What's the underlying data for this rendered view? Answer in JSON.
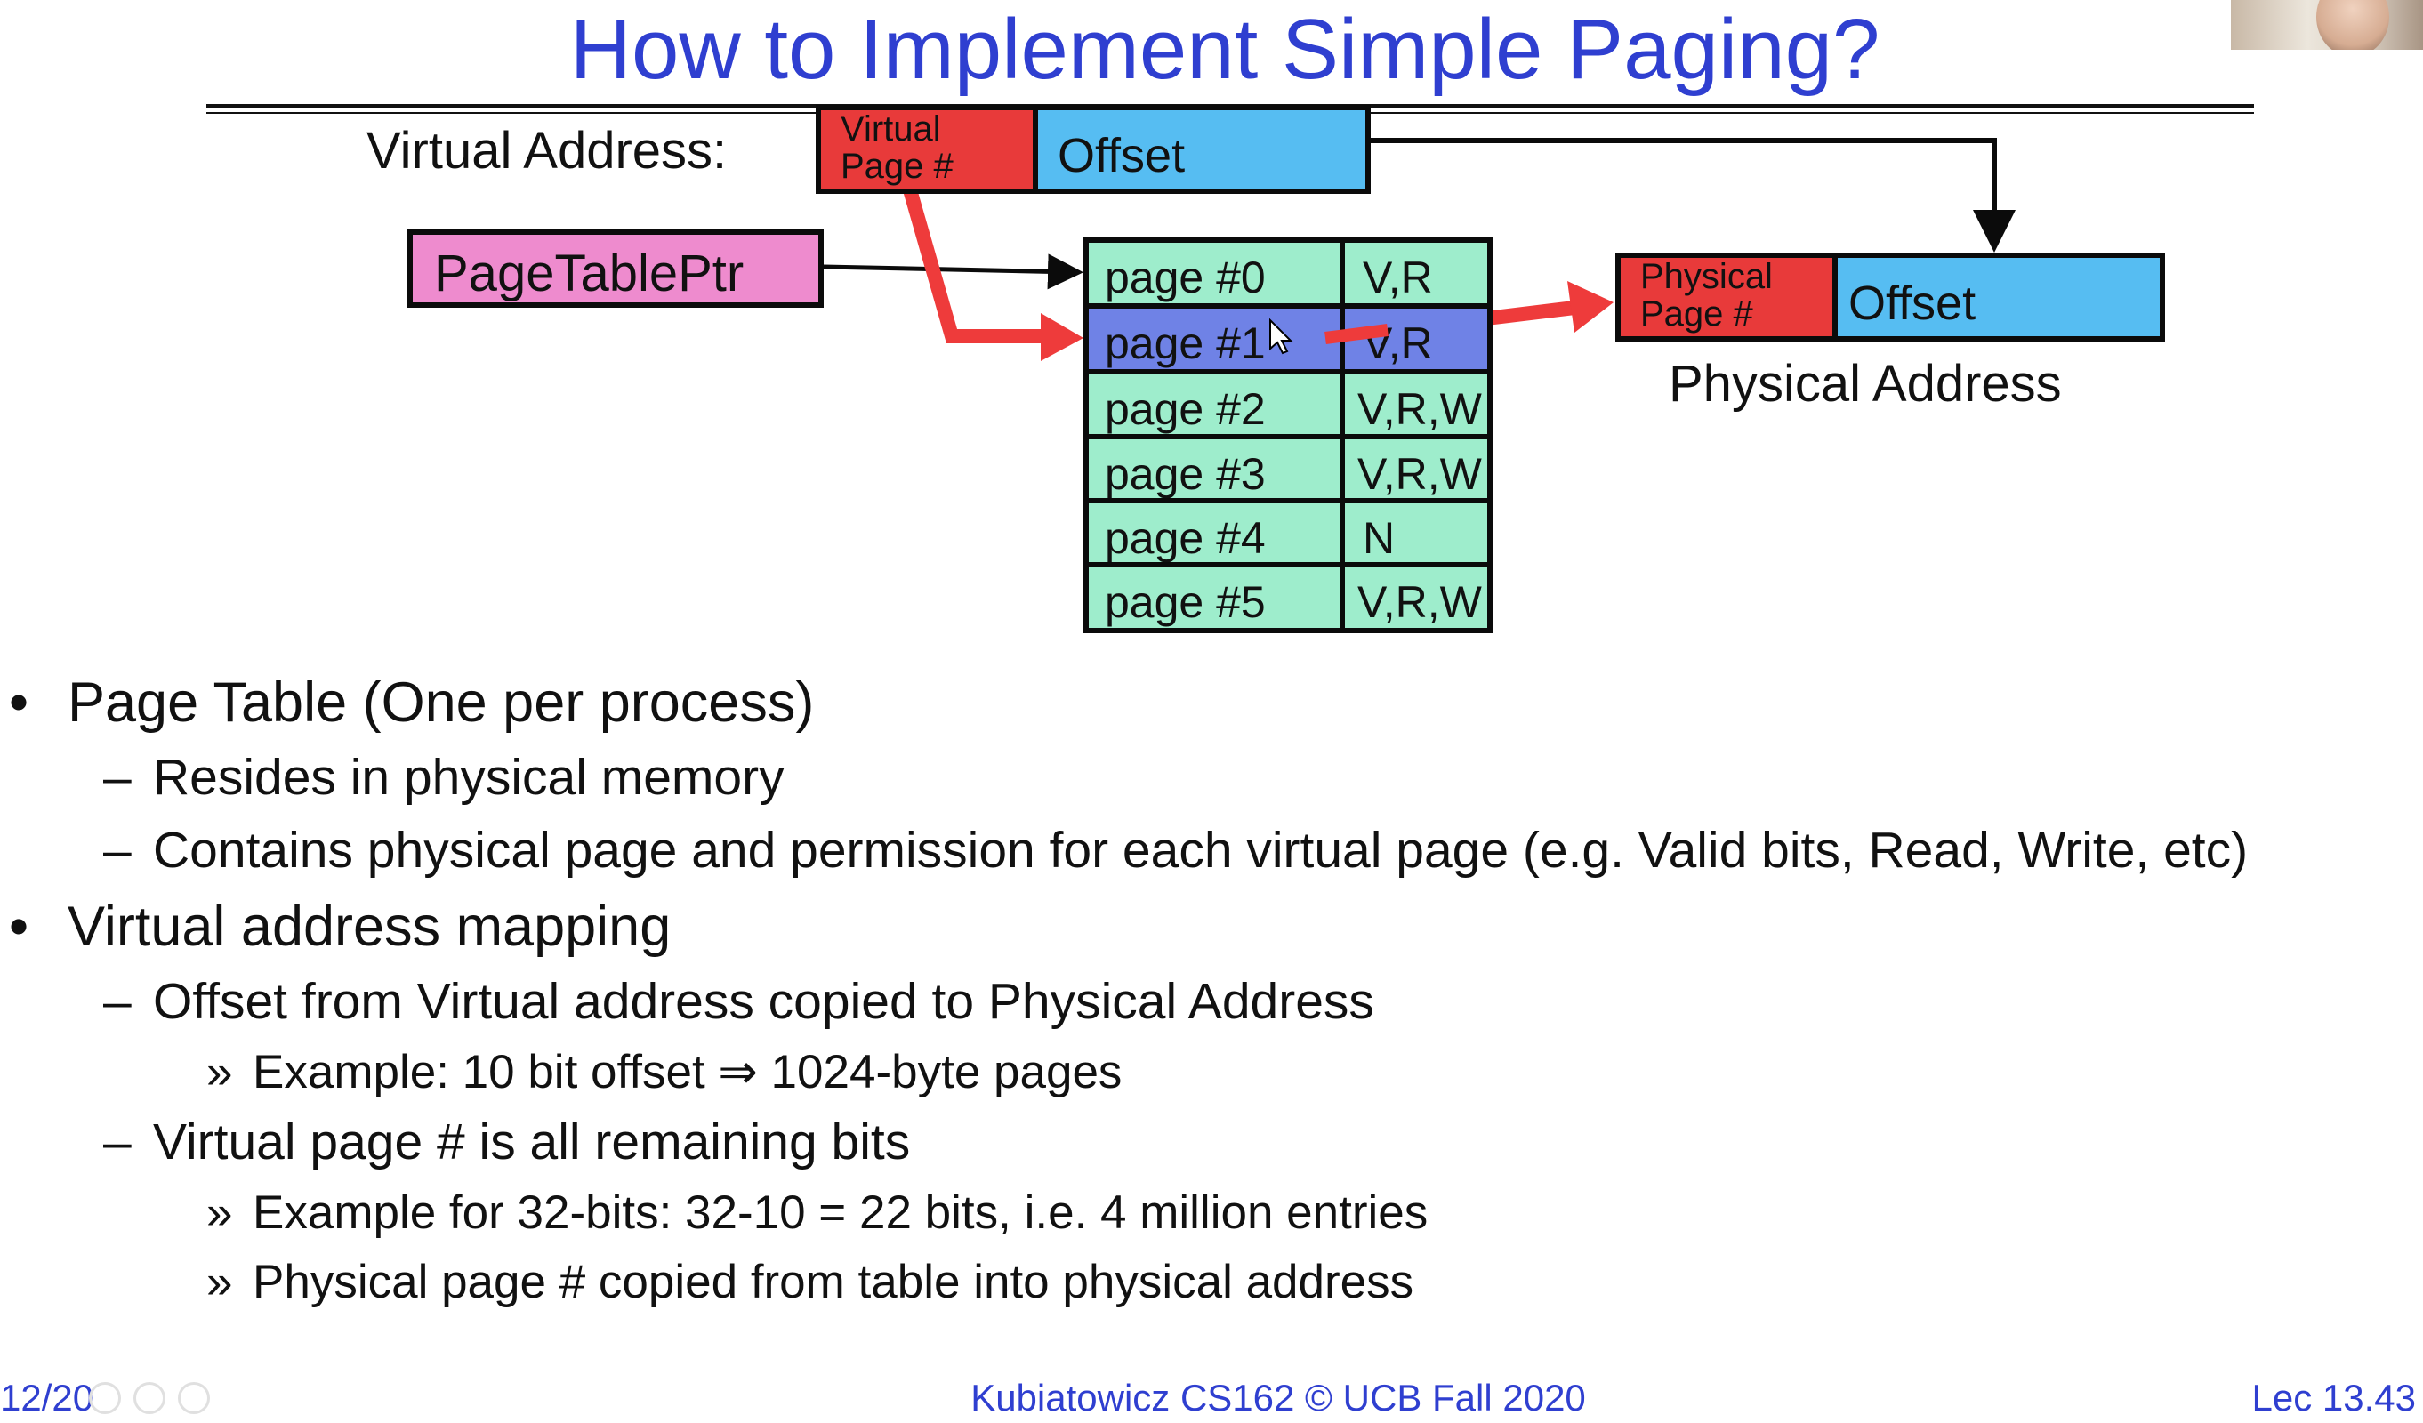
{
  "slide": {
    "title": "How to Implement Simple Paging?",
    "virtual_address_label": "Virtual Address:",
    "va_vpn_line1": "Virtual",
    "va_vpn_line2": "Page #",
    "va_offset": "Offset",
    "page_table_ptr": "PageTablePtr",
    "page_table": [
      {
        "page": "page #0",
        "perm": "V,R"
      },
      {
        "page": "page #1",
        "perm": "V,R"
      },
      {
        "page": "page #2",
        "perm": "V,R,W"
      },
      {
        "page": "page #3",
        "perm": "V,R,W"
      },
      {
        "page": "page #4",
        "perm": "N"
      },
      {
        "page": "page #5",
        "perm": "V,R,W"
      }
    ],
    "pa_ppn_line1": "Physical",
    "pa_ppn_line2": "Page #",
    "pa_offset": "Offset",
    "physical_address_label": "Physical Address",
    "bullets": [
      "Page Table (One per process)",
      "Resides in physical memory",
      "Contains physical page and permission for each virtual page (e.g. Valid bits, Read, Write, etc)",
      "Virtual address mapping",
      "Offset from Virtual address copied to Physical Address",
      "Example: 10 bit offset ⇒ 1024-byte pages",
      "Virtual page # is all remaining bits",
      "Example for 32-bits: 32-10 = 22 bits, i.e. 4 million entries",
      "Physical page # copied from table into physical address"
    ],
    "markers": {
      "bullet": "•",
      "dash": "–",
      "sub": "»"
    }
  },
  "footer": {
    "page_counter": "12/20",
    "center": "Kubiatowicz CS162 © UCB Fall 2020",
    "right": "Lec 13.43"
  },
  "colors": {
    "title": "#2f3fd0",
    "red": "#e83a3a",
    "blue": "#56bdf2",
    "pink": "#ee8bce",
    "green": "#9eedcc",
    "highlight": "#6f82e6",
    "arrow_red": "#ee3b3b"
  }
}
